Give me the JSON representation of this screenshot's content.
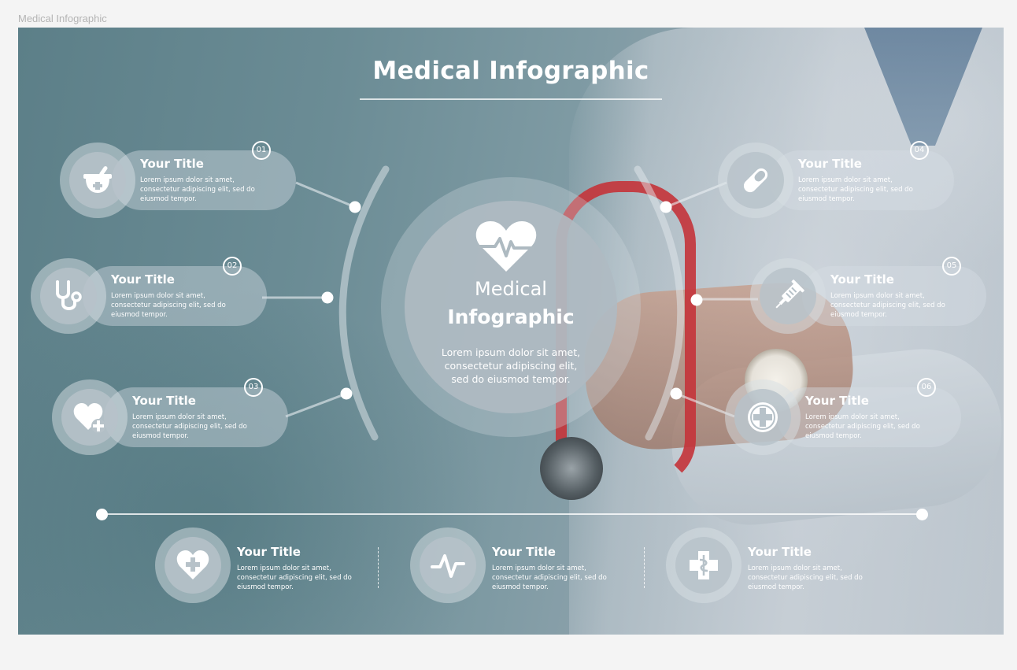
{
  "frame_label": "Medical Infographic",
  "header": {
    "title": "Medical Infographic"
  },
  "center": {
    "line1": "Medical",
    "line2": "Infographic",
    "description": "Lorem ipsum dolor sit amet, consectetur adipiscing elit, sed do eiusmod tempor."
  },
  "items": [
    {
      "number": "01",
      "title": "Your Title",
      "text": "Lorem ipsum dolor sit amet, consectetur adipiscing elit, sed do eiusmod tempor.",
      "icon": "mortar-pestle-icon"
    },
    {
      "number": "02",
      "title": "Your Title",
      "text": "Lorem ipsum dolor sit amet, consectetur adipiscing elit, sed do eiusmod tempor.",
      "icon": "stethoscope-icon"
    },
    {
      "number": "03",
      "title": "Your Title",
      "text": "Lorem ipsum dolor sit amet, consectetur adipiscing elit, sed do eiusmod tempor.",
      "icon": "heart-plus-icon"
    },
    {
      "number": "04",
      "title": "Your Title",
      "text": "Lorem ipsum dolor sit amet, consectetur adipiscing elit, sed do eiusmod tempor.",
      "icon": "pill-icon"
    },
    {
      "number": "05",
      "title": "Your Title",
      "text": "Lorem ipsum dolor sit amet, consectetur adipiscing elit, sed do eiusmod tempor.",
      "icon": "syringe-icon"
    },
    {
      "number": "06",
      "title": "Your Title",
      "text": "Lorem ipsum dolor sit amet, consectetur adipiscing elit, sed do eiusmod tempor.",
      "icon": "medical-cross-icon"
    }
  ],
  "bottom_items": [
    {
      "title": "Your Title",
      "text": "Lorem ipsum dolor sit amet, consectetur adipiscing elit, sed do eiusmod tempor.",
      "icon": "heart-cross-icon"
    },
    {
      "title": "Your Title",
      "text": "Lorem ipsum dolor sit amet, consectetur adipiscing elit, sed do eiusmod tempor.",
      "icon": "pulse-icon"
    },
    {
      "title": "Your Title",
      "text": "Lorem ipsum dolor sit amet, consectetur adipiscing elit, sed do eiusmod tempor.",
      "icon": "pharmacy-cross-icon"
    }
  ],
  "colors": {
    "accent": "#ffffff",
    "background": "#7e9aa3"
  }
}
